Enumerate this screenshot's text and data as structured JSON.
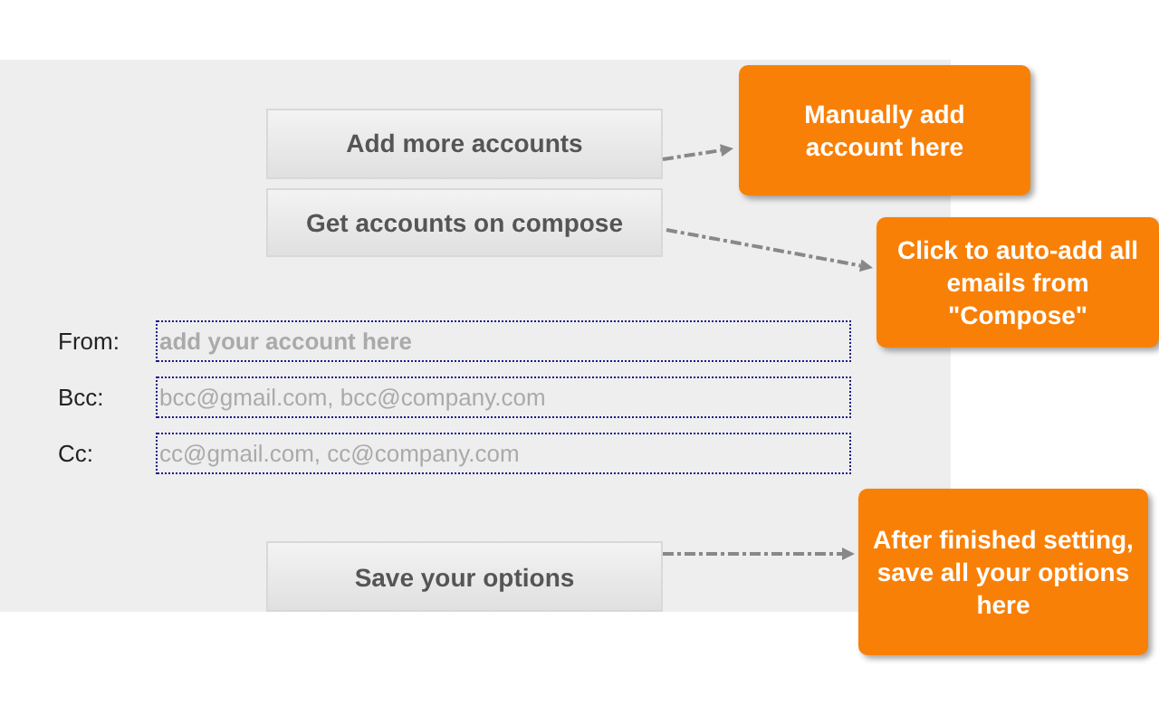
{
  "buttons": [
    {
      "label": "Add more accounts"
    },
    {
      "label": "Get accounts on compose"
    }
  ],
  "fields": [
    {
      "label": "From:",
      "placeholder": "add your account here",
      "bold": true
    },
    {
      "label": "Bcc:",
      "placeholder": "bcc@gmail.com, bcc@company.com",
      "bold": false
    },
    {
      "label": "Cc:",
      "placeholder": "cc@gmail.com, cc@company.com",
      "bold": false
    }
  ],
  "save_button": {
    "label": "Save your options"
  },
  "callouts": [
    {
      "text": "Manually add account here"
    },
    {
      "text": "Click to auto-add all emails from \"Compose\""
    },
    {
      "text": "After finished setting, save all your options here"
    }
  ]
}
